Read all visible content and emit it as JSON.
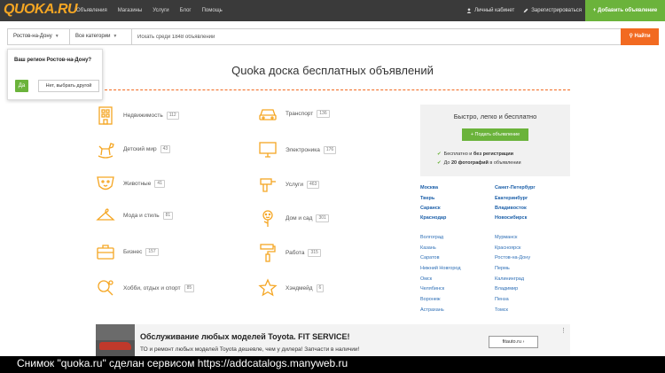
{
  "header": {
    "logo": "QUOKA.RU",
    "nav": [
      "Объявления",
      "Магазины",
      "Услуги",
      "Блог",
      "Помощь"
    ],
    "cabinet": "Личный кабинет",
    "register": "Зарегистрироваться",
    "add_ad": "+ Добавить объявление"
  },
  "search": {
    "region": "Ростов-на-Дону",
    "category": "Все категории",
    "placeholder": "Искать среди 1848 объявлений",
    "button": "Найти"
  },
  "region_popup": {
    "question": "Ваш регион Ростов-на-Дону?",
    "yes": "Да",
    "no": "Нет, выбрать другой"
  },
  "page_title": "Quoka доска бесплатных объявлений",
  "categories": {
    "left": [
      {
        "label": "Недвижимость",
        "count": "112",
        "icon": "building-icon"
      },
      {
        "label": "Детский мир",
        "count": "43",
        "icon": "rocking-horse-icon"
      },
      {
        "label": "Животные",
        "count": "41",
        "icon": "pet-icon"
      },
      {
        "label": "Мода и стиль",
        "count": "81",
        "icon": "hanger-icon"
      },
      {
        "label": "Бизнес",
        "count": "157",
        "icon": "briefcase-icon"
      },
      {
        "label": "Хобби, отдых и спорт",
        "count": "85",
        "icon": "ping-pong-icon"
      }
    ],
    "right": [
      {
        "label": "Транспорт",
        "count": "136",
        "icon": "car-icon"
      },
      {
        "label": "Электроника",
        "count": "176",
        "icon": "monitor-icon"
      },
      {
        "label": "Услуги",
        "count": "463",
        "icon": "drill-icon"
      },
      {
        "label": "Дом и сад",
        "count": "301",
        "icon": "sunflower-icon"
      },
      {
        "label": "Работа",
        "count": "315",
        "icon": "paint-roller-icon"
      },
      {
        "label": "Хэндмейд",
        "count": "6",
        "icon": "star-icon"
      }
    ]
  },
  "promo": {
    "title": "Быстро, легко и бесплатно",
    "button": "+ Подать объявление",
    "feature1_a": "Бесплатно и ",
    "feature1_b": "без регистрации",
    "feature2_a": "До ",
    "feature2_b": "20 фотографий",
    "feature2_c": " в объявлении"
  },
  "cities": {
    "major_left": [
      "Москва",
      "Тверь",
      "Саранск",
      "Краснодар"
    ],
    "major_right": [
      "Санкт-Петербург",
      "Екатеринбург",
      "Владивосток",
      "Новосибирск"
    ],
    "minor_left": [
      "Волгоград",
      "Казань",
      "Саратов",
      "Нижний Новгород",
      "Омск",
      "Челябинск",
      "Воронеж",
      "Астрахань"
    ],
    "minor_right": [
      "Мурманск",
      "Красноярск",
      "Ростов-на-Дону",
      "Пермь",
      "Калининград",
      "Владимир",
      "Пенза",
      "Томск"
    ]
  },
  "ad": {
    "title": "Обслуживание любых моделей Toyota. FIT SERVICE!",
    "desc": "ТО и ремонт любых моделей Toyota дешевле, чем у дилера! Запчасти в наличии!",
    "button": "fitauto.ru ›",
    "menu": "⋮"
  },
  "caption": "Снимок \"quoka.ru\" сделан сервисом https://addcatalogs.manyweb.ru",
  "colors": {
    "accent": "#f26a21",
    "green": "#6bb33b",
    "icon": "#f5a623",
    "link": "#1a5ea8"
  }
}
